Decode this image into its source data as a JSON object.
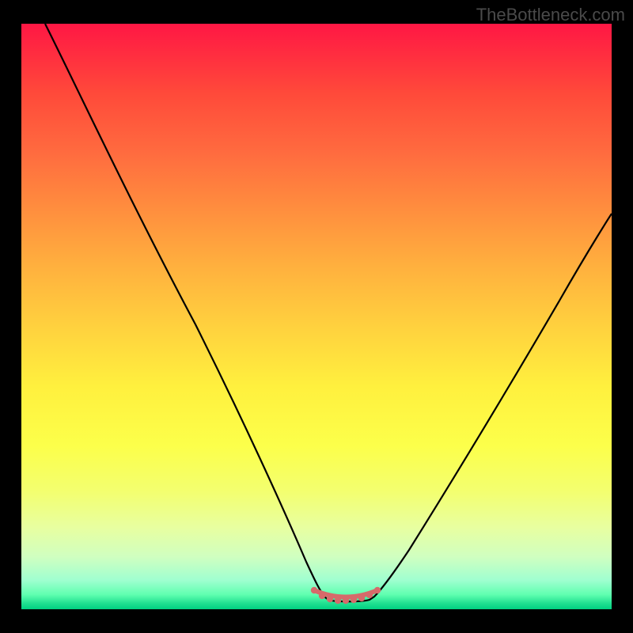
{
  "watermark": "TheBottleneck.com",
  "chart_data": {
    "type": "line",
    "title": "",
    "xlabel": "",
    "ylabel": "",
    "xlim": [
      0,
      100
    ],
    "ylim": [
      0,
      100
    ],
    "series": [
      {
        "name": "curve",
        "x": [
          4,
          10,
          20,
          30,
          40,
          47,
          49,
          51,
          53,
          55,
          57,
          59,
          62,
          70,
          80,
          90,
          100
        ],
        "y": [
          100,
          86,
          65,
          45,
          25,
          10,
          4,
          1,
          0.5,
          0.5,
          0.8,
          1.5,
          4,
          15,
          32,
          50,
          70
        ]
      },
      {
        "name": "marker-band",
        "x": [
          49,
          50.5,
          52,
          53.5,
          55,
          56.5,
          58,
          59.5,
          61
        ],
        "y": [
          3.2,
          2.0,
          1.4,
          1.2,
          1.2,
          1.4,
          1.8,
          2.4,
          3.4
        ]
      }
    ],
    "gradient_note": "background vertical gradient red->orange->yellow->green",
    "optimum_range_x": [
      49,
      61
    ]
  }
}
